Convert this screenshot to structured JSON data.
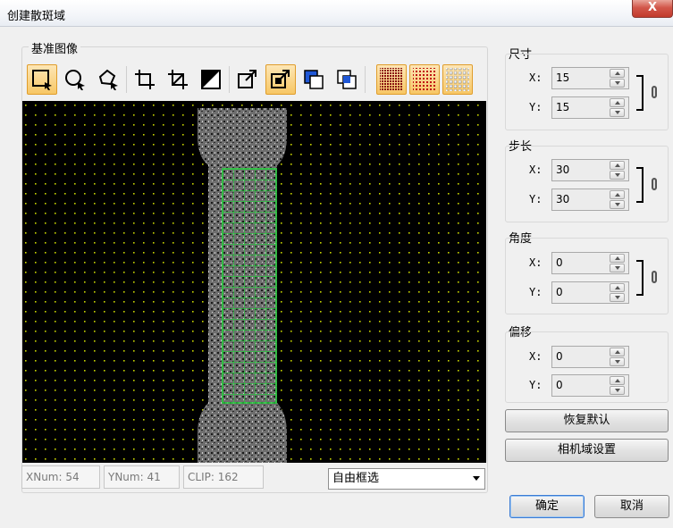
{
  "window": {
    "title": "创建散斑域",
    "close_label": "X"
  },
  "image_frame": {
    "title": "基准图像"
  },
  "toolbar": {
    "tools": [
      {
        "name": "rect-select-icon",
        "active": true
      },
      {
        "name": "circle-select-icon",
        "active": false
      },
      {
        "name": "polygon-select-icon",
        "active": false
      },
      {
        "name": "crop-icon",
        "active": false
      },
      {
        "name": "clear-crop-icon",
        "active": false
      },
      {
        "name": "invert-icon",
        "active": false
      },
      {
        "name": "export-icon",
        "active": false
      },
      {
        "name": "export-active-icon",
        "active": true
      },
      {
        "name": "union-icon",
        "active": false
      },
      {
        "name": "intersect-icon",
        "active": false
      },
      {
        "name": "grid-dense-icon",
        "active": false
      },
      {
        "name": "grid-medium-icon",
        "active": false
      },
      {
        "name": "grid-sparse-icon",
        "active": false
      }
    ]
  },
  "status": {
    "xnum": "XNum: 54",
    "ynum": "YNum: 41",
    "clip": "CLIP: 162"
  },
  "mode_select": {
    "value": "自由框选"
  },
  "size": {
    "title": "尺寸",
    "x_label": "X:",
    "x_value": "15",
    "y_label": "Y:",
    "y_value": "15"
  },
  "step": {
    "title": "步长",
    "x_label": "X:",
    "x_value": "30",
    "y_label": "Y:",
    "y_value": "30"
  },
  "angle": {
    "title": "角度",
    "x_label": "X:",
    "x_value": "0",
    "y_label": "Y:",
    "y_value": "0"
  },
  "offset": {
    "title": "偏移",
    "x_label": "X:",
    "x_value": "0",
    "y_label": "Y:",
    "y_value": "0"
  },
  "buttons": {
    "restore_default": "恢复默认",
    "camera_settings": "相机域设置",
    "ok": "确定",
    "cancel": "取消"
  },
  "colors": {
    "grid_dots": "#c8d400",
    "selection_grid": "#22d13a",
    "specimen": "#7a7a7a",
    "active_tool": "#f7c765"
  }
}
